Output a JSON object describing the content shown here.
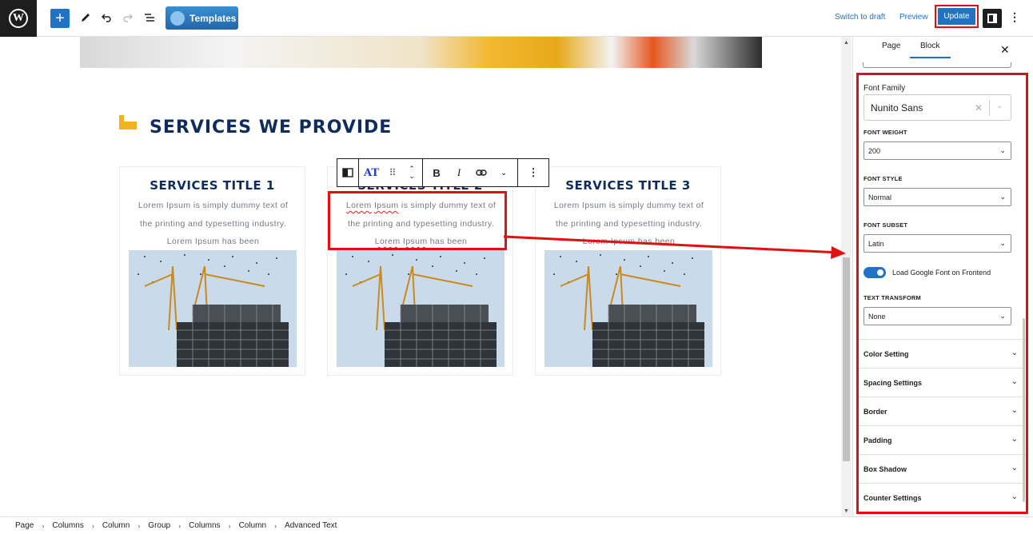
{
  "toolbar": {
    "logo_letter": "W",
    "add_icon": "+",
    "templates_label": "Templates",
    "switch_draft": "Switch to draft",
    "preview": "Preview",
    "update": "Update"
  },
  "content": {
    "section_title": "SERVICES WE PROVIDE",
    "cards": [
      {
        "title": "SERVICES TITLE 1",
        "line1": "Lorem Ipsum is simply dummy text of",
        "line2": "the printing and typesetting industry.",
        "line3": "Lorem Ipsum has been"
      },
      {
        "title": "SERVICES TITLE 2",
        "line1_a": "Lorem",
        "line1_b": "Ipsum",
        "line1_c": " is simply dummy text of",
        "line2": "the printing and typesetting industry.",
        "line3_a": "Lorem",
        "line3_b": "Ipsum",
        "line3_c": " has been"
      },
      {
        "title": "SERVICES TITLE 3",
        "line1": "Lorem Ipsum is simply dummy text of",
        "line2": "the printing and typesetting industry.",
        "line3": "Lorem Ipsum has been"
      }
    ],
    "block_toolbar": {
      "at_label": "AT",
      "bold": "B",
      "italic": "I"
    }
  },
  "sidebar": {
    "tabs": [
      "Page",
      "Block"
    ],
    "active_tab": "Block",
    "font_family_label": "Font Family",
    "font_family_value": "Nunito Sans",
    "font_weight_label": "FONT WEIGHT",
    "font_weight_value": "200",
    "font_style_label": "FONT STYLE",
    "font_style_value": "Normal",
    "font_subset_label": "FONT SUBSET",
    "font_subset_value": "Latin",
    "load_google_font_label": "Load Google Font on Frontend",
    "load_google_font_on": true,
    "text_transform_label": "TEXT TRANSFORM",
    "text_transform_value": "None",
    "accordions": [
      "Color Setting",
      "Spacing Settings",
      "Border",
      "Padding",
      "Box Shadow",
      "Counter Settings"
    ]
  },
  "breadcrumb": [
    "Page",
    "Columns",
    "Column",
    "Group",
    "Columns",
    "Column",
    "Advanced Text"
  ],
  "colors": {
    "accent": "#1f72c4",
    "highlight": "#e01010",
    "title": "#0f2d5c",
    "icon_yellow": "#f0b423"
  }
}
